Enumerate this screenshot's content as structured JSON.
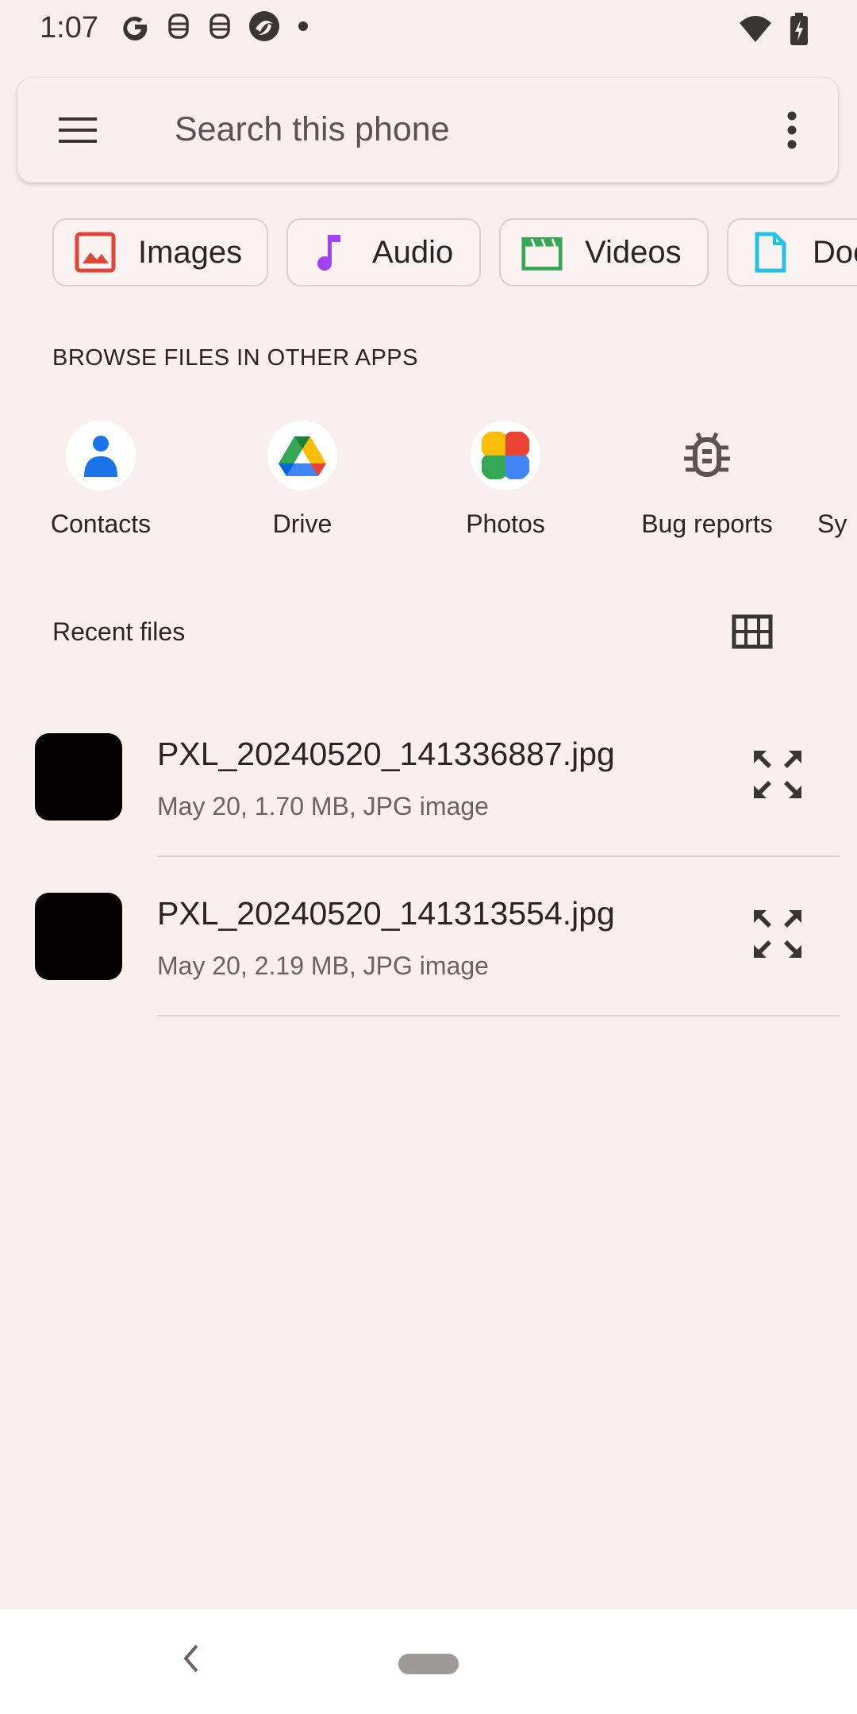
{
  "status_bar": {
    "time": "1:07",
    "left_icons": [
      "google-icon",
      "notification-icon",
      "notification-icon",
      "app-icon",
      "dot-icon"
    ],
    "right_icons": [
      "wifi-icon",
      "battery-charging-icon"
    ]
  },
  "search": {
    "placeholder": "Search this phone"
  },
  "chips": [
    {
      "label": "Images",
      "icon": "image-icon",
      "color": "#e0453a"
    },
    {
      "label": "Audio",
      "icon": "music-note-icon",
      "color": "#a142f4"
    },
    {
      "label": "Videos",
      "icon": "video-clapper-icon",
      "color": "#34a853"
    },
    {
      "label": "Doc",
      "icon": "document-icon",
      "color": "#24c1e0"
    }
  ],
  "browse_section": {
    "title": "BROWSE FILES IN OTHER APPS",
    "apps": [
      {
        "label": "Contacts",
        "icon": "contacts-icon"
      },
      {
        "label": "Drive",
        "icon": "drive-icon"
      },
      {
        "label": "Photos",
        "icon": "photos-icon"
      },
      {
        "label": "Bug reports",
        "icon": "bug-icon"
      },
      {
        "label": "Sy",
        "icon": "system-icon"
      }
    ]
  },
  "recent": {
    "title": "Recent files",
    "files": [
      {
        "name": "PXL_20240520_141336887.jpg",
        "meta": "May 20, 1.70 MB, JPG image"
      },
      {
        "name": "PXL_20240520_141313554.jpg",
        "meta": "May 20, 2.19 MB, JPG image"
      }
    ]
  }
}
